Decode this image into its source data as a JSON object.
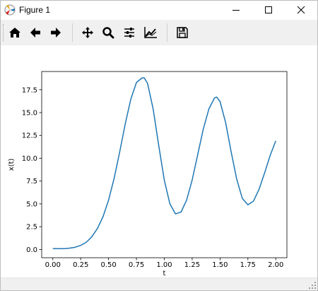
{
  "window": {
    "title": "Figure 1",
    "controls": [
      "minimize",
      "maximize",
      "close"
    ]
  },
  "toolbar": {
    "buttons": [
      {
        "name": "home",
        "icon": "home-icon"
      },
      {
        "name": "back",
        "icon": "arrow-left-icon"
      },
      {
        "name": "forward",
        "icon": "arrow-right-icon"
      },
      {
        "name": "pan",
        "icon": "move-icon"
      },
      {
        "name": "zoom",
        "icon": "magnifier-icon"
      },
      {
        "name": "configure-subplots",
        "icon": "sliders-icon"
      },
      {
        "name": "edit-axis",
        "icon": "line-chart-icon"
      },
      {
        "name": "save",
        "icon": "floppy-disk-icon"
      }
    ]
  },
  "chart_data": {
    "type": "line",
    "title": "",
    "xlabel": "t",
    "ylabel": "x(t)",
    "xlim": [
      -0.1,
      2.1
    ],
    "ylim": [
      -0.9,
      19.5
    ],
    "xticks": [
      "0.00",
      "0.25",
      "0.50",
      "0.75",
      "1.00",
      "1.25",
      "1.50",
      "1.75",
      "2.00"
    ],
    "yticks": [
      "0.0",
      "2.5",
      "5.0",
      "7.5",
      "10.0",
      "12.5",
      "15.0",
      "17.5"
    ],
    "grid": false,
    "line_color": "#1f77b4",
    "series": [
      {
        "x": [
          0.0,
          0.05,
          0.1,
          0.15,
          0.2,
          0.25,
          0.3,
          0.35,
          0.4,
          0.45,
          0.5,
          0.55,
          0.6,
          0.65,
          0.7,
          0.75,
          0.8,
          0.82,
          0.85,
          0.9,
          0.95,
          1.0,
          1.05,
          1.1,
          1.15,
          1.2,
          1.25,
          1.3,
          1.35,
          1.4,
          1.45,
          1.47,
          1.5,
          1.55,
          1.6,
          1.65,
          1.7,
          1.75,
          1.8,
          1.85,
          1.9,
          1.95,
          2.0
        ],
        "values": [
          0.1,
          0.1,
          0.1,
          0.15,
          0.25,
          0.45,
          0.8,
          1.4,
          2.3,
          3.6,
          5.4,
          7.8,
          10.7,
          13.8,
          16.5,
          18.3,
          18.8,
          18.8,
          18.2,
          15.4,
          11.4,
          7.6,
          5.0,
          3.9,
          4.1,
          5.4,
          7.6,
          10.4,
          13.2,
          15.4,
          16.6,
          16.7,
          16.2,
          13.9,
          10.7,
          7.7,
          5.6,
          4.9,
          5.3,
          6.6,
          8.4,
          10.3,
          11.9
        ]
      }
    ]
  }
}
